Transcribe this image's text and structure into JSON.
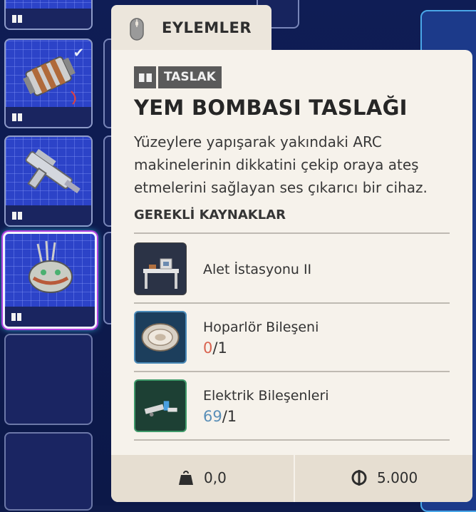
{
  "tab": {
    "label": "EYLEMLER",
    "icon": "mouse-icon"
  },
  "card": {
    "badge": {
      "label": "TASLAK",
      "icon": "book-icon"
    },
    "title": "YEM BOMBASI TASLAĞI",
    "description": "Yüzeylere yapışarak yakındaki ARC makinelerinin dikkatini çekip oraya ateş etmelerini sağlayan ses çıkarıcı bir cihaz.",
    "requirements_heading": "GEREKLİ KAYNAKLAR",
    "requirements": [
      {
        "name": "Alet İstasyonu II",
        "icon": "workbench-icon"
      },
      {
        "name": "Hoparlör Bileşeni",
        "have": "0",
        "need": "/1",
        "have_color": "#d9634f",
        "icon": "speaker-component-icon"
      },
      {
        "name": "Elektrik Bileşenleri",
        "have": "69",
        "need": "/1",
        "have_color": "#5a8fb8",
        "icon": "electrical-components-icon"
      }
    ],
    "footer": {
      "weight": "0,0",
      "weight_icon": "weight-icon",
      "price": "5.000",
      "price_icon": "coin-icon"
    }
  },
  "inventory": {
    "slots": [
      {
        "state": "filled",
        "icon": "lure-grenade-item-icon",
        "checked": true
      },
      {
        "state": "filled",
        "icon": "weapon-blueprint-icon",
        "checked": false
      },
      {
        "state": "filled",
        "icon": "lure-bomb-item-icon",
        "checked": false,
        "selected": true
      },
      {
        "state": "empty"
      },
      {
        "state": "empty"
      }
    ]
  },
  "colors": {
    "background": "#0e1a4a",
    "slot_grid": "#2c43c8",
    "card": "#f6f2eb",
    "tab": "#ece6dc",
    "badge": "#5a5a5a"
  }
}
